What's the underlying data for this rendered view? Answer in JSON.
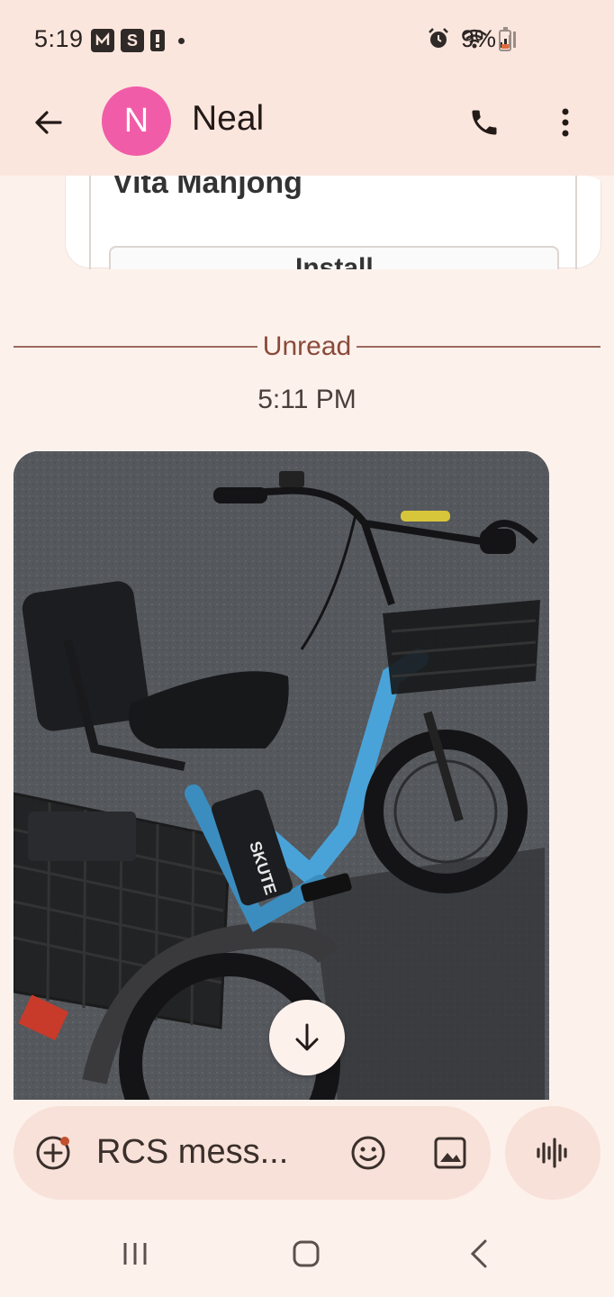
{
  "status_bar": {
    "time": "5:19",
    "notification_icons": [
      "n-app-icon",
      "s-app-icon",
      "alert-icon"
    ],
    "battery_percent": "9%"
  },
  "header": {
    "avatar_letter": "N",
    "avatar_color": "#f15ca8",
    "contact_name": "Neal"
  },
  "conversation": {
    "card": {
      "title": "Vita Mahjong",
      "button_label": "Install"
    },
    "unread_label": "Unread",
    "timestamp": "5:11 PM",
    "photo": {
      "description_icon": "tricycle-photo",
      "frame_text": "SKUTE"
    }
  },
  "composer": {
    "placeholder": "RCS mess..."
  },
  "colors": {
    "accent_bg": "#fbe6de",
    "conversation_bg": "#fdf1ec",
    "composer_bg": "#f8e1d8",
    "unread_color": "#8a4a3a"
  }
}
